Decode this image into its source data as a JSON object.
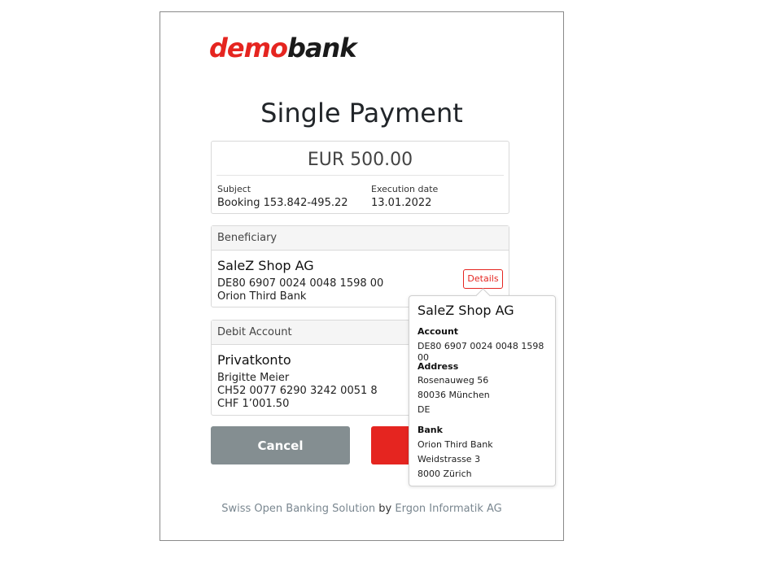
{
  "logo": {
    "demo": "demo",
    "bank": "bank"
  },
  "page_title": "Single Payment",
  "payment": {
    "amount": "EUR 500.00",
    "subject_label": "Subject",
    "subject_value": "Booking 153.842-495.22",
    "execution_label": "Execution date",
    "execution_value": "13.01.2022"
  },
  "beneficiary": {
    "header": "Beneficiary",
    "name": "SaleZ Shop AG",
    "iban": "DE80 6907 0024 0048 1598 00",
    "bank": "Orion Third Bank",
    "details_label": "Details"
  },
  "debit_account": {
    "header": "Debit Account",
    "name": "Privatkonto",
    "holder": "Brigitte Meier",
    "iban": "CH52 0077 6290 3242 0051 8",
    "balance": "CHF 1’001.50"
  },
  "actions": {
    "cancel_label": "Cancel",
    "confirm_label": ""
  },
  "footer": {
    "solution": "Swiss Open Banking Solution",
    "by": "by",
    "company": "Ergon Informatik AG"
  },
  "popover": {
    "title": "SaleZ Shop AG",
    "account_label": "Account",
    "account_value": "DE80 6907 0024 0048 1598 00",
    "address_label": "Address",
    "address_lines": [
      "Rosenauweg 56",
      "80036 München",
      "DE"
    ],
    "bank_label": "Bank",
    "bank_lines": [
      "Orion Third Bank",
      "Weidstrasse 3",
      "8000 Zürich"
    ]
  },
  "colors": {
    "brand_red": "#e52520",
    "cancel_gray": "#848e91"
  }
}
